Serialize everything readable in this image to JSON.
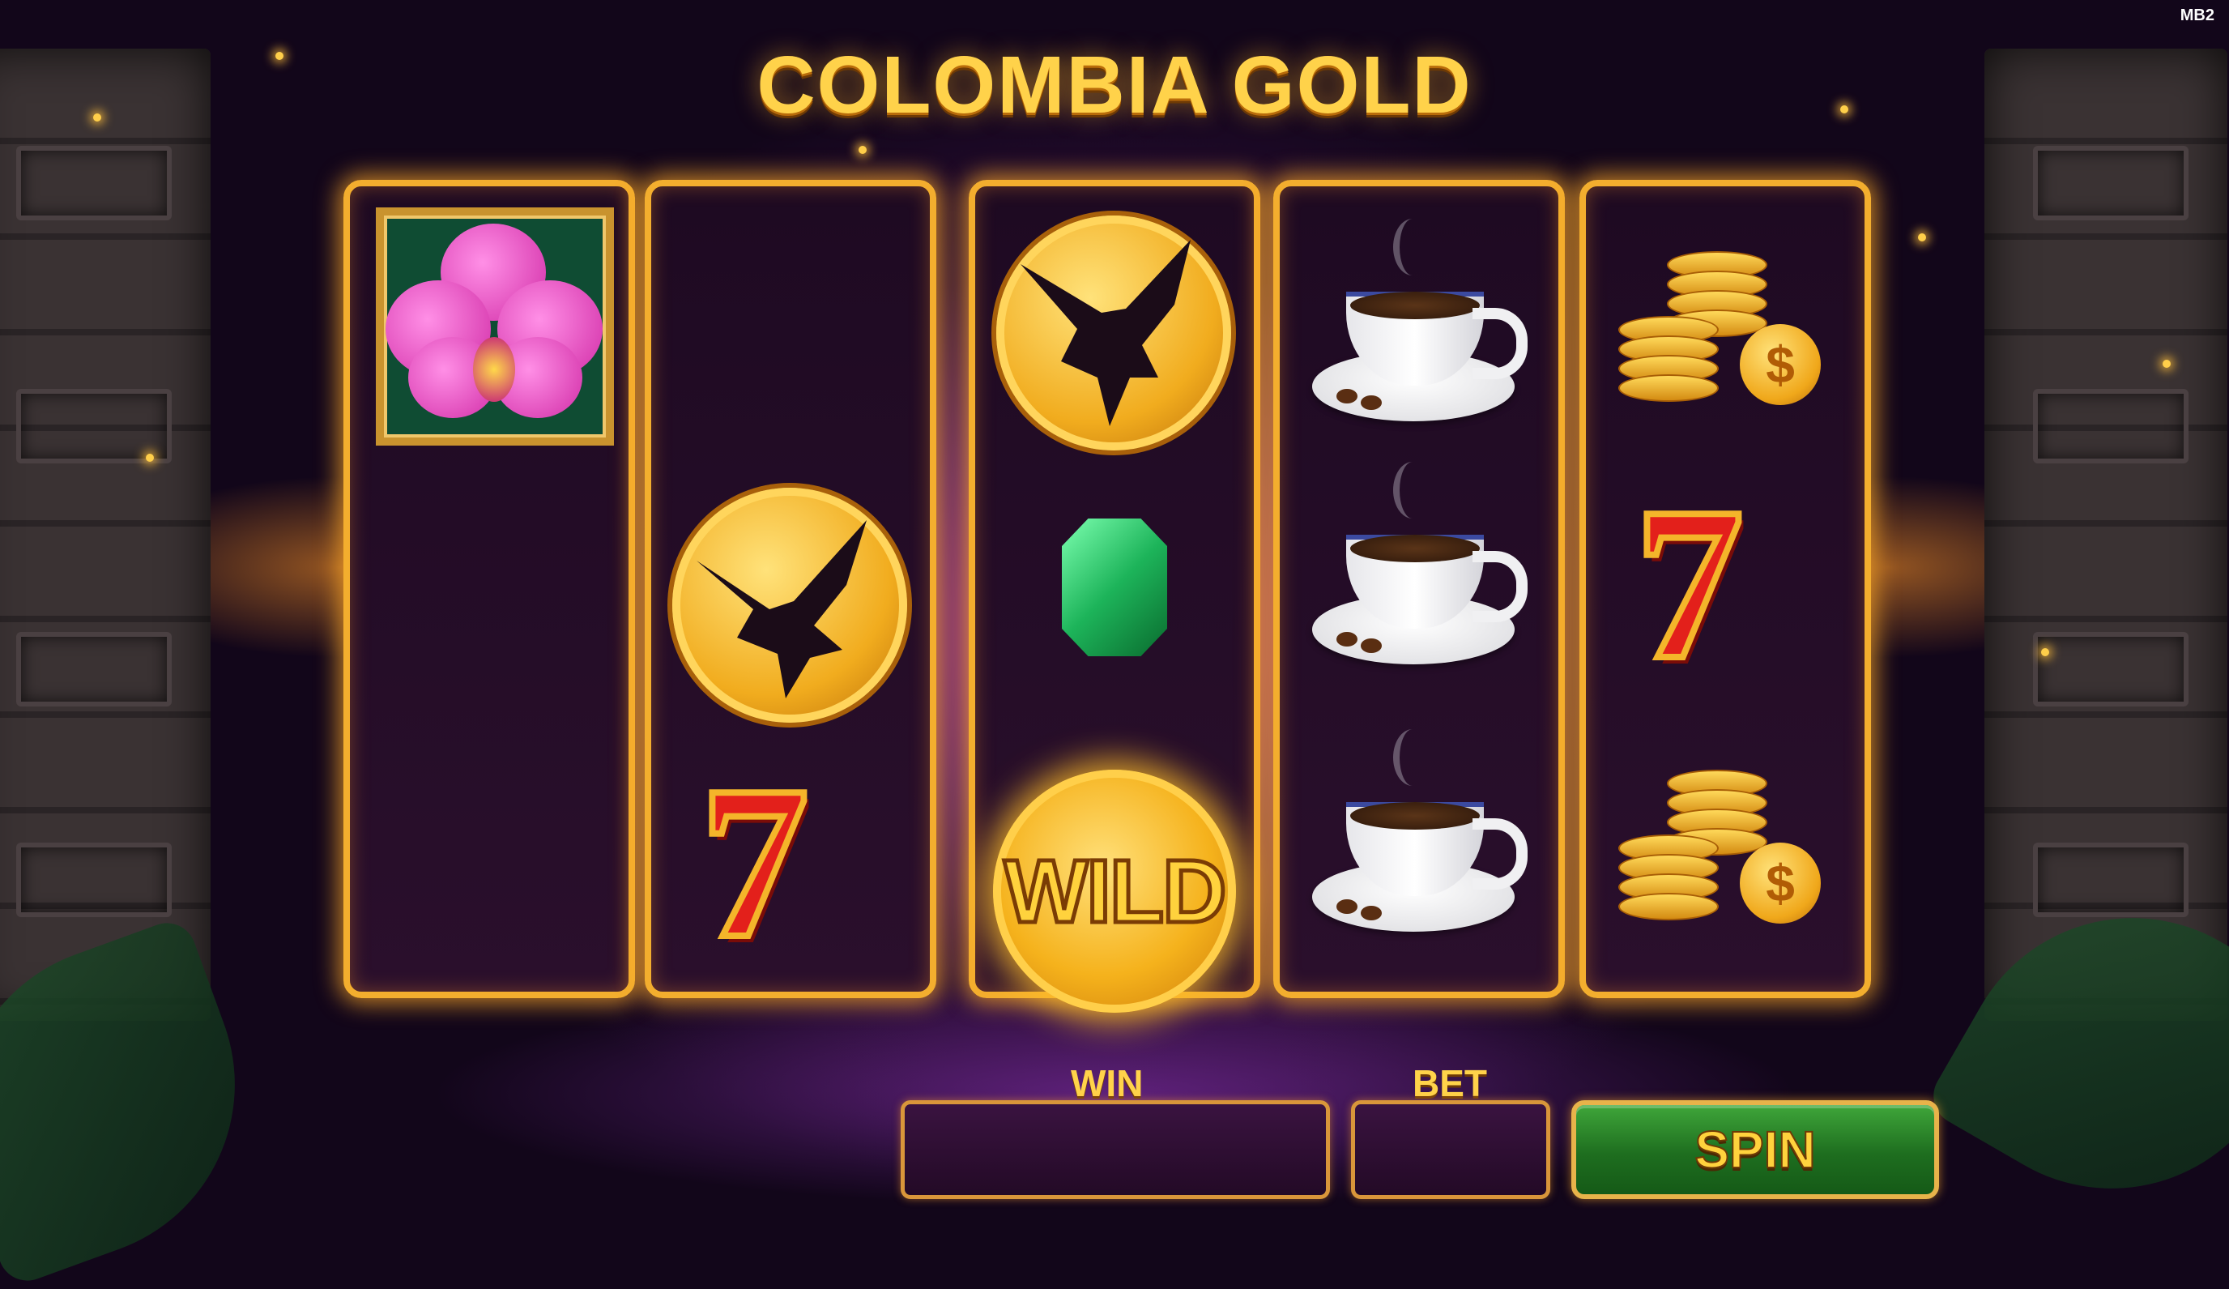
{
  "game": {
    "title": "COLOMBIA GOLD",
    "corner_tag": "MB2"
  },
  "reels": [
    {
      "symbols": [
        "orchid-icon"
      ]
    },
    {
      "symbols": [
        "eagle-coin-icon",
        "seven-icon"
      ]
    },
    {
      "symbols": [
        "eagle-coin-icon",
        "emerald-icon",
        "wild-icon"
      ]
    },
    {
      "symbols": [
        "coffee-cup-icon",
        "coffee-cup-icon",
        "coffee-cup-icon"
      ]
    },
    {
      "symbols": [
        "gold-coins-icon",
        "seven-icon",
        "gold-coins-icon"
      ]
    }
  ],
  "symbol_text": {
    "seven": "7",
    "wild": "WILD",
    "dollar": "$"
  },
  "controls": {
    "win_label": "WIN",
    "win_value": "",
    "bet_label": "BET",
    "bet_value": "",
    "spin_label": "SPIN"
  },
  "colors": {
    "gold": "#f3ae2e",
    "spin_green": "#2f8a2c",
    "background_purple": "#5a1e6a"
  }
}
